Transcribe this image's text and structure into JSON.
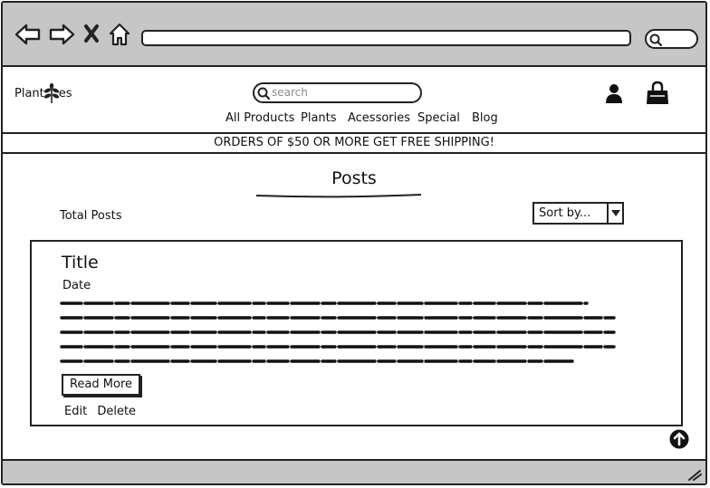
{
  "browser": {
    "search_placeholder": ""
  },
  "header": {
    "logo_left": "Plant",
    "logo_right": "es",
    "search_placeholder": "search",
    "nav": [
      "All Products",
      "Plants",
      "Acessories",
      "Special",
      "Blog"
    ]
  },
  "promo": {
    "text": "ORDERS OF $50 OR MORE GET FREE SHIPPING!"
  },
  "main": {
    "title": "Posts",
    "total_label": "Total Posts",
    "sort_value": "Sort by..."
  },
  "post": {
    "title": "Title",
    "date": "Date",
    "read_more": "Read More",
    "edit": "Edit",
    "delete": "Delete"
  },
  "icons": {
    "back": "back-arrow-icon",
    "forward": "forward-arrow-icon",
    "stop": "close-icon",
    "home": "home-icon",
    "browser_search": "search-icon",
    "site_search": "search-icon",
    "logo": "leaf-icon",
    "user": "user-icon",
    "cart": "shopping-bag-icon",
    "sort": "chevron-down-icon",
    "scroll_top": "arrow-up-circle-icon",
    "resize": "resize-grip-icon"
  }
}
